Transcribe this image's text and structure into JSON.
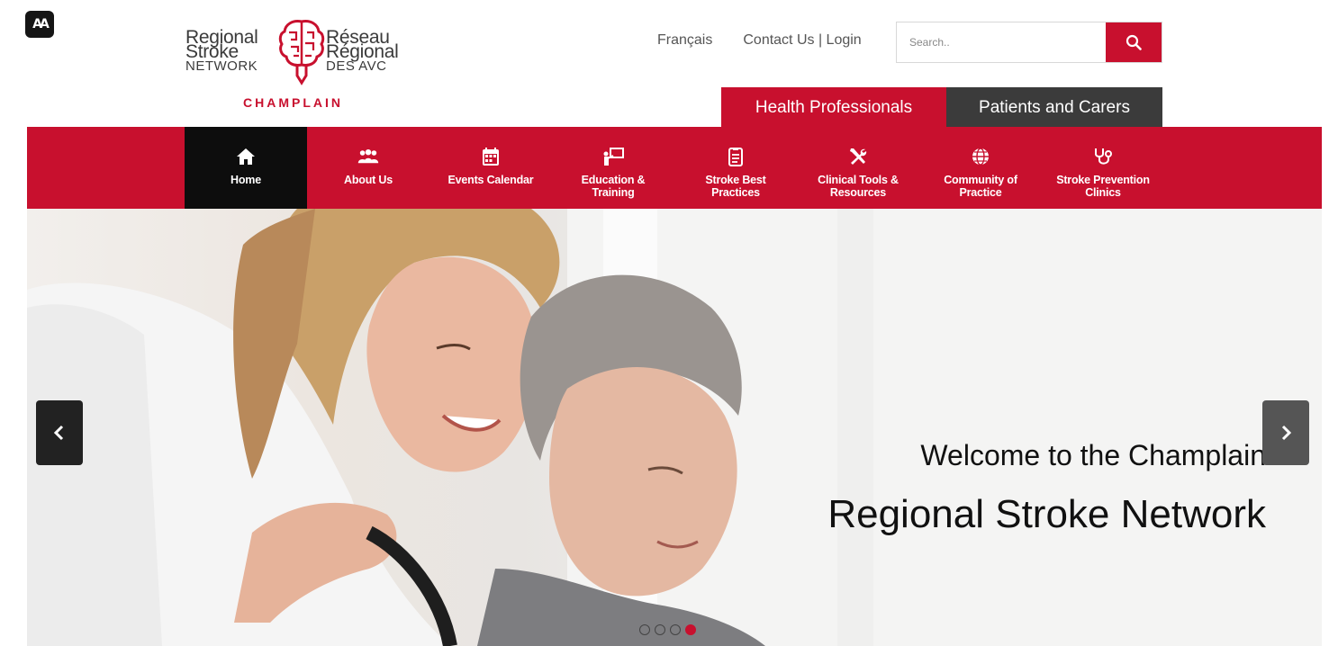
{
  "accessibility": {
    "label": "AA"
  },
  "logo": {
    "left_line1": "Regional",
    "left_line2": "Stroke",
    "left_line3": "NETWORK",
    "right_line1": "Réseau",
    "right_line2": "Régional",
    "right_line3": "DES AVC",
    "subtitle": "CHAMPLAIN"
  },
  "top_links": {
    "language": "Français",
    "contact_login": "Contact Us | Login"
  },
  "search": {
    "placeholder": "Search..",
    "icon": "search-icon"
  },
  "audience_tabs": [
    {
      "label": "Health Professionals",
      "active": true
    },
    {
      "label": "Patients and Carers",
      "active": false
    }
  ],
  "nav": [
    {
      "label": "Home",
      "icon": "home-icon",
      "active": true
    },
    {
      "label": "About Us",
      "icon": "people-icon",
      "active": false
    },
    {
      "label": "Events Calendar",
      "icon": "calendar-icon",
      "active": false
    },
    {
      "label": "Education &\nTraining",
      "icon": "presentation-icon",
      "active": false
    },
    {
      "label": "Stroke Best\nPractices",
      "icon": "clipboard-icon",
      "active": false
    },
    {
      "label": "Clinical Tools &\nResources",
      "icon": "tools-icon",
      "active": false
    },
    {
      "label": "Community of\nPractice",
      "icon": "globe-icon",
      "active": false
    },
    {
      "label": "Stroke Prevention\nClinics",
      "icon": "stethoscope-icon",
      "active": false
    }
  ],
  "hero": {
    "line1": "Welcome to the Champlain",
    "line2": "Regional Stroke Network",
    "image": "caregiver-with-elderly-woman",
    "slides_total": 4,
    "active_slide": 4
  },
  "colors": {
    "brand_red": "#c8102e",
    "dark_tab": "#3b3b3b",
    "active_nav": "#0d0d0d"
  }
}
